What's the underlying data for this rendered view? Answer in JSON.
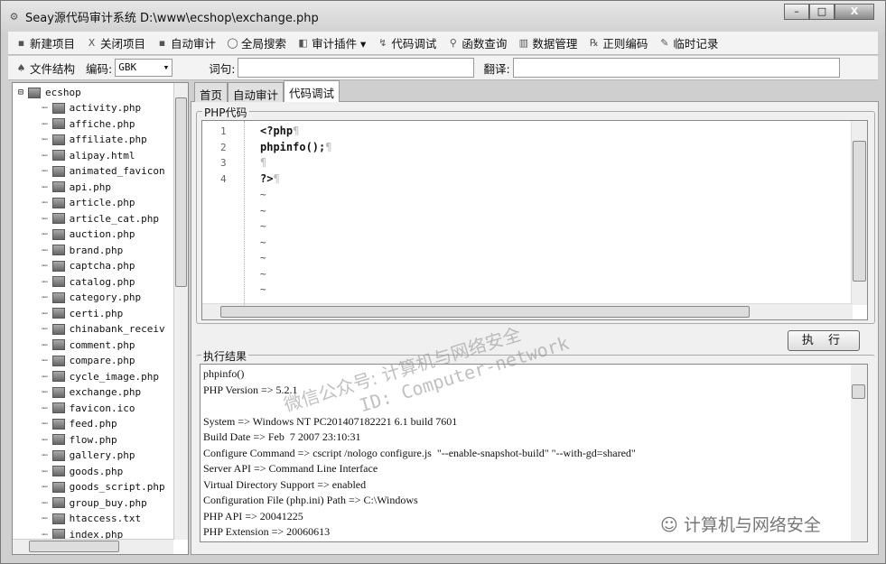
{
  "window": {
    "title": "Seay源代码审计系统  D:\\www\\ecshop\\exchange.php",
    "min": "–",
    "max": "□",
    "close": "X"
  },
  "toolbar1": [
    {
      "icon": "new-project-icon",
      "glyph": "▪",
      "label": "新建项目"
    },
    {
      "icon": "close-project-icon",
      "glyph": "X",
      "label": "关闭项目"
    },
    {
      "icon": "auto-audit-icon",
      "glyph": "▪",
      "label": "自动审计"
    },
    {
      "icon": "global-search-icon",
      "glyph": "◯",
      "label": "全局搜索"
    },
    {
      "icon": "plugin-icon",
      "glyph": "◧",
      "label": "审计插件 ▾"
    },
    {
      "icon": "code-debug-icon",
      "glyph": "↯",
      "label": "代码调试"
    },
    {
      "icon": "function-query-icon",
      "glyph": "⚲",
      "label": "函数查询"
    },
    {
      "icon": "data-manage-icon",
      "glyph": "▥",
      "label": "数据管理"
    },
    {
      "icon": "regex-encode-icon",
      "glyph": "℞",
      "label": "正则编码"
    },
    {
      "icon": "temp-record-icon",
      "glyph": "✎",
      "label": "临时记录"
    }
  ],
  "toolbar2": {
    "file_structure": "文件结构",
    "encoding_label": "编码:",
    "encoding_value": "GBK",
    "word_label": "词句:",
    "word_value": "",
    "translate_label": "翻译:",
    "translate_value": ""
  },
  "tree": {
    "root": "ecshop",
    "items": [
      "activity.php",
      "affiche.php",
      "affiliate.php",
      "alipay.html",
      "animated_favicon",
      "api.php",
      "article.php",
      "article_cat.php",
      "auction.php",
      "brand.php",
      "captcha.php",
      "catalog.php",
      "category.php",
      "certi.php",
      "chinabank_receiv",
      "comment.php",
      "compare.php",
      "cycle_image.php",
      "exchange.php",
      "favicon.ico",
      "feed.php",
      "flow.php",
      "gallery.php",
      "goods.php",
      "goods_script.php",
      "group_buy.php",
      "htaccess.txt",
      "index.php"
    ]
  },
  "tabs": [
    {
      "label": "首页",
      "active": false
    },
    {
      "label": "自动审计",
      "active": false
    },
    {
      "label": "代码调试",
      "active": true
    }
  ],
  "code_group": "PHP代码",
  "code": {
    "line_numbers": [
      "1",
      "2",
      "3",
      "4"
    ],
    "lines": [
      "<?php",
      "phpinfo();",
      "",
      "?>"
    ],
    "pilcrow": "¶",
    "tilde": "~"
  },
  "run_button": "执 行",
  "result_group": "执行结果",
  "result_lines": [
    "phpinfo()",
    "PHP Version => 5.2.1",
    "",
    "System => Windows NT PC201407182221 6.1 build 7601",
    "Build Date => Feb  7 2007 23:10:31",
    "Configure Command => cscript /nologo configure.js  \"--enable-snapshot-build\" \"--with-gd=shared\"",
    "Server API => Command Line Interface",
    "Virtual Directory Support => enabled",
    "Configuration File (php.ini) Path => C:\\Windows",
    "PHP API => 20041225",
    "PHP Extension => 20060613"
  ],
  "watermark": {
    "line1": "微信公众号: 计算机与网络安全",
    "line2": "ID: Computer-network",
    "corner": "计算机与网络安全"
  }
}
